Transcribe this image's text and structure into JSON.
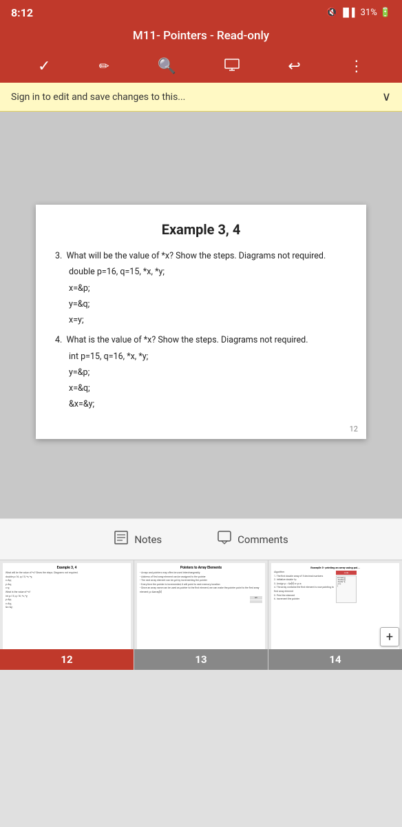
{
  "statusBar": {
    "time": "8:12",
    "battery": "31%",
    "icons": "🔇 📶 31%🔋"
  },
  "titleBar": {
    "title": "M11- Pointers - Read-only"
  },
  "toolbar": {
    "checkIcon": "✓",
    "penIcon": "✏",
    "searchIcon": "🔍",
    "presentIcon": "▶",
    "undoIcon": "↩",
    "moreIcon": "⋮"
  },
  "signinBar": {
    "text": "Sign in to edit and save changes to this...",
    "chevron": "∨"
  },
  "slide": {
    "title": "Example 3, 4",
    "content": [
      "3.  What will be the value of *x? Show the steps. Diagrams not required.",
      "    double p=16, q=15, *x, *y;",
      "    x=&p;",
      "    y=&q;",
      "    x=y;",
      "4.  What is the value of *x? Show the steps. Diagrams not required.",
      "    int p=15, q=16, *x, *y;",
      "    y=&p;",
      "    x=&q;",
      "    &x=&y;"
    ],
    "pageNumber": "12"
  },
  "actionBar": {
    "notesLabel": "Notes",
    "commentsLabel": "Comments"
  },
  "thumbnails": [
    {
      "number": "12",
      "title": "Example 3, 4",
      "lines": [
        "What will be the value of *x? Show the steps. Diagrams not required.",
        "double p=16, q=15, *x, *y;",
        "x=&p;",
        "y=&q;",
        "x=y;",
        "What is the value of *x? Show the steps.",
        "int p=15, q=16, *x, *y;",
        "y=&p;",
        "x=&q;",
        "&x=&y;"
      ]
    },
    {
      "number": "13",
      "title": "Pointers to Array Elements",
      "lines": [
        "Arrays and pointers may often be used interchangeably",
        "Address of first array element can be assigned to the pointer",
        "The next array element can be got by incrementing the pointer",
        "Every time the pointer is incremented it will point to the next memory location or next array element",
        "Since an array name can be used as pointer to the first element in an array, we can make the pointer point to the first array element by computing the address of the first array element; that is, p=&array[0]"
      ]
    },
    {
      "number": "14",
      "title": "Example 5- printing an array using poi...",
      "lines": [
        "Algorithm",
        "The first double array of 5 decimal numbers",
        "Initialize double *p",
        "Assign p = &a[0] or p=a",
        "The array contains the first element from array is now pointing to the first array element",
        "Print the element",
        "Increment the pointer until all elements printed"
      ]
    }
  ]
}
